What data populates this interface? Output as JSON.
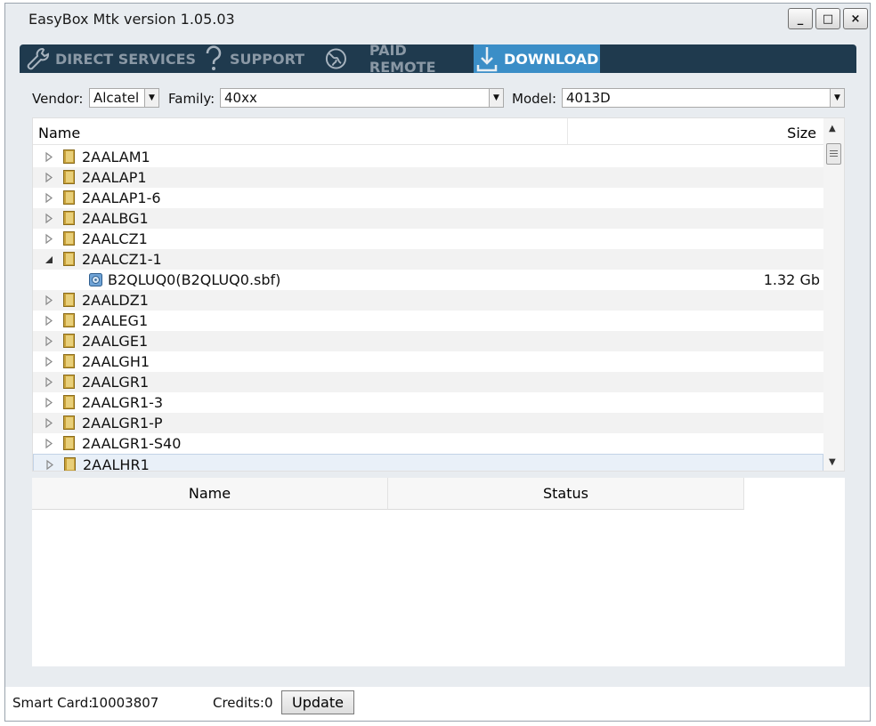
{
  "window": {
    "title": "EasyBox Mtk version 1.05.03",
    "minimize_label": "_",
    "maximize_label": "□",
    "close_label": "×"
  },
  "tabs": [
    {
      "label": "DIRECT SERVICES",
      "icon": "wrench-icon",
      "active": false
    },
    {
      "label": "SUPPORT",
      "icon": "question-icon",
      "active": false
    },
    {
      "label": "PAID REMOTE",
      "icon": "globe-icon",
      "active": false
    },
    {
      "label": "DOWNLOAD",
      "icon": "download-icon",
      "active": true
    }
  ],
  "filters": {
    "vendor_label": "Vendor:",
    "vendor_value": "Alcatel",
    "family_label": "Family:",
    "family_value": "40xx",
    "model_label": "Model:",
    "model_value": "4013D"
  },
  "tree": {
    "col_name": "Name",
    "col_size": "Size",
    "rows": [
      {
        "label": "2AALAM1",
        "expanded": false
      },
      {
        "label": "2AALAP1",
        "expanded": false
      },
      {
        "label": "2AALAP1-6",
        "expanded": false
      },
      {
        "label": "2AALBG1",
        "expanded": false
      },
      {
        "label": "2AALCZ1",
        "expanded": false
      },
      {
        "label": "2AALCZ1-1",
        "expanded": true
      },
      {
        "label": "B2QLUQ0(B2QLUQ0.sbf)",
        "size": "1.32 Gb",
        "child": true
      },
      {
        "label": "2AALDZ1",
        "expanded": false
      },
      {
        "label": "2AALEG1",
        "expanded": false
      },
      {
        "label": "2AALGE1",
        "expanded": false
      },
      {
        "label": "2AALGH1",
        "expanded": false
      },
      {
        "label": "2AALGR1",
        "expanded": false
      },
      {
        "label": "2AALGR1-3",
        "expanded": false
      },
      {
        "label": "2AALGR1-P",
        "expanded": false
      },
      {
        "label": "2AALGR1-S40",
        "expanded": false
      },
      {
        "label": "2AALHR1",
        "expanded": false,
        "selected": true
      }
    ]
  },
  "queue": {
    "col_name": "Name",
    "col_status": "Status"
  },
  "statusbar": {
    "smart_card_label": "Smart Card:",
    "smart_card_value": "10003807",
    "credits_label": "Credits:",
    "credits_value": "0",
    "update_label": "Update"
  },
  "colors": {
    "toolbar_bg": "#1f3a4e",
    "active_tab": "#3b8ec7",
    "folder": "#c9a23a"
  }
}
